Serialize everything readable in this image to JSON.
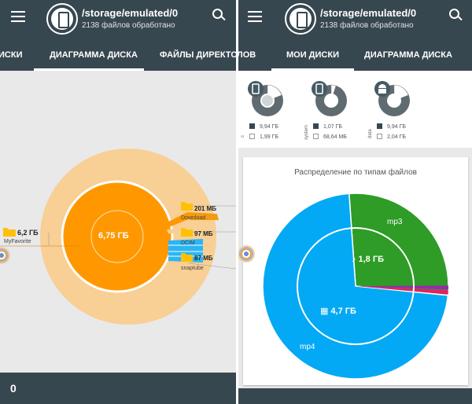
{
  "left": {
    "appbar": {
      "title": "/storage/emulated/0",
      "subtitle": "2138 файлов обработано"
    },
    "tabs": [
      {
        "label": "ИСКИ"
      },
      {
        "label": "ДИАГРАММА ДИСКА"
      },
      {
        "label": "ФАЙЛЫ ДИРЕКТОРИ"
      }
    ],
    "active_tab": "ДИАГРАММА ДИСКА",
    "center_label": "6,75 ГБ",
    "callouts": [
      {
        "size": "6,2 ГБ",
        "name": "MyFavorite"
      },
      {
        "size": "201 МБ",
        "name": "Download"
      },
      {
        "size": "97 МБ",
        "name": "DCIM"
      },
      {
        "size": "87 МБ",
        "name": "snaptube"
      }
    ],
    "bottom": {
      "count": "0"
    },
    "colors": {
      "orange": "#ff9800",
      "light_orange": "#f8cf94",
      "blue": "#29b6f6"
    }
  },
  "right": {
    "appbar": {
      "title": "/storage/emulated/0",
      "subtitle": "2138 файлов обработано"
    },
    "tabs": [
      {
        "label": "ЛОВ"
      },
      {
        "label": "МОИ ДИСКИ"
      },
      {
        "label": "ДИАГРАММА ДИСКА"
      }
    ],
    "active_tab": "МОИ ДИСКИ",
    "disks": [
      {
        "icon": "phone-icon",
        "vertical_label": "c",
        "used": "9,94 ГБ",
        "free": "1,99 ГБ",
        "used_fraction": 0.83
      },
      {
        "icon": "phone-icon",
        "vertical_label": "system",
        "used": "1,07 ГБ",
        "free": "68,64 МБ",
        "used_fraction": 0.94
      },
      {
        "icon": "android-icon",
        "vertical_label": "data",
        "used": "9,94 ГБ",
        "free": "2,04 ГБ",
        "used_fraction": 0.83
      }
    ],
    "file_types": {
      "title": "Распределение по типам файлов",
      "labels": {
        "mp3": "mp3",
        "mp4": "mp4"
      },
      "inner_mp3": "1,8 ГБ",
      "inner_mp4": "4,7 ГБ"
    },
    "colors": {
      "mp4": "#03a9f4",
      "mp3": "#2e9c26",
      "other1": "#9c27b0",
      "other2": "#e91e63"
    }
  },
  "chart_data": {
    "type": "pie",
    "title": "Распределение по типам файлов",
    "categories": [
      "mp4",
      "mp3"
    ],
    "values": [
      4.7,
      1.8
    ],
    "unit": "ГБ"
  }
}
